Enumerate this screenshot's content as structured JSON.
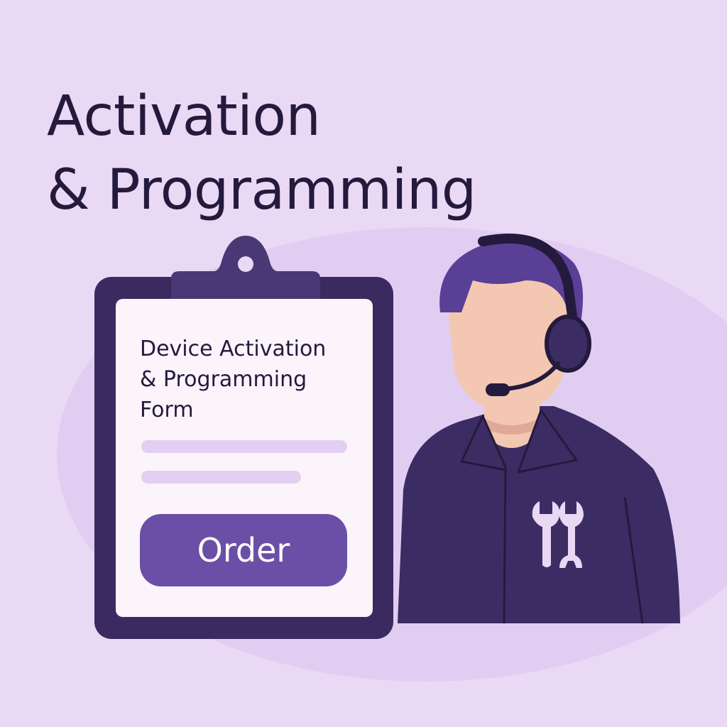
{
  "headline": {
    "line1": "Activation",
    "line2": "& Programming"
  },
  "form": {
    "title_line1": "Device Activation",
    "title_line2": "& Programming",
    "title_line3": "Form",
    "order_button": "Order"
  },
  "colors": {
    "background": "#ead9f5",
    "headline": "#241a3d",
    "clipboard": "#3a2a5f",
    "button": "#6b4fa6",
    "shirt": "#3b2d63",
    "hair": "#5a3f96",
    "skin": "#f3c7b2"
  },
  "icons": {
    "shirt_logo": "wrench-icon"
  }
}
